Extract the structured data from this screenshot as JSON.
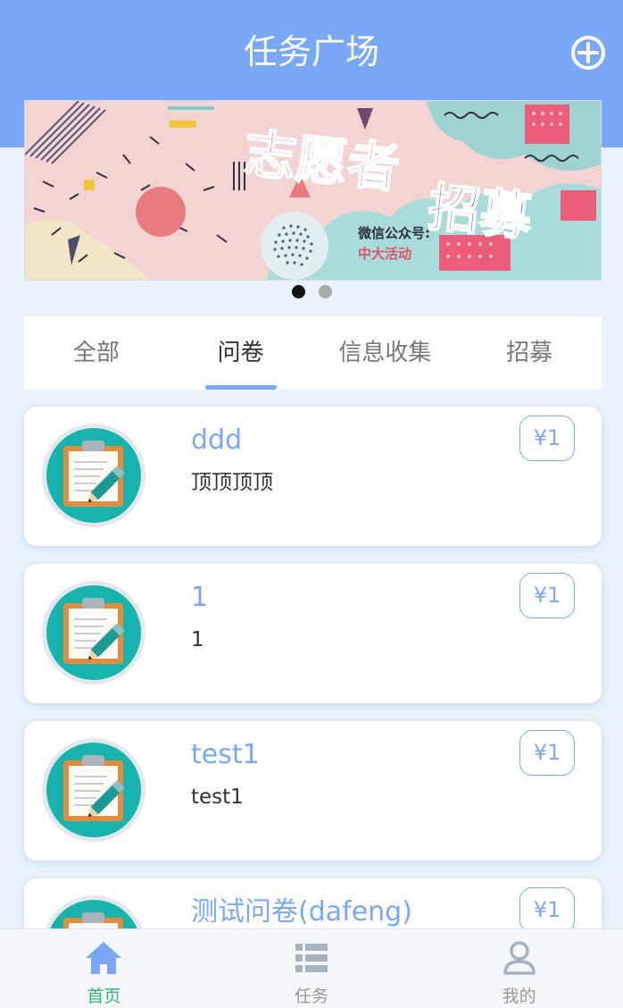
{
  "header": {
    "title": "任务广场",
    "add_icon": "plus-circle-icon"
  },
  "banner": {
    "headline_line1": "志愿者",
    "headline_line2": "招募",
    "wechat_label": "微信公众号:",
    "wechat_name": "中大活动",
    "slide_count": 2,
    "active_slide": 1
  },
  "tabs": [
    {
      "label": "全部",
      "active": false
    },
    {
      "label": "问卷",
      "active": true
    },
    {
      "label": "信息收集",
      "active": false
    },
    {
      "label": "招募",
      "active": false
    }
  ],
  "tasks": [
    {
      "title": "ddd",
      "description": "顶顶顶顶",
      "price": "¥1",
      "icon": "clipboard-pencil-icon"
    },
    {
      "title": "1",
      "description": "1",
      "price": "¥1",
      "icon": "clipboard-pencil-icon"
    },
    {
      "title": "test1",
      "description": "test1",
      "price": "¥1",
      "icon": "clipboard-pencil-icon"
    },
    {
      "title": "测试问卷(dafeng)",
      "description": "",
      "price": "¥1",
      "icon": "clipboard-pencil-icon"
    }
  ],
  "bottom_nav": [
    {
      "label": "首页",
      "icon": "home-icon",
      "active": true
    },
    {
      "label": "任务",
      "icon": "list-icon",
      "active": false
    },
    {
      "label": "我的",
      "icon": "user-icon",
      "active": false
    }
  ],
  "colors": {
    "primary": "#79a8f9",
    "background": "#eaf3fc",
    "nav_active": "#2bb673",
    "nav_inactive": "#999999"
  }
}
